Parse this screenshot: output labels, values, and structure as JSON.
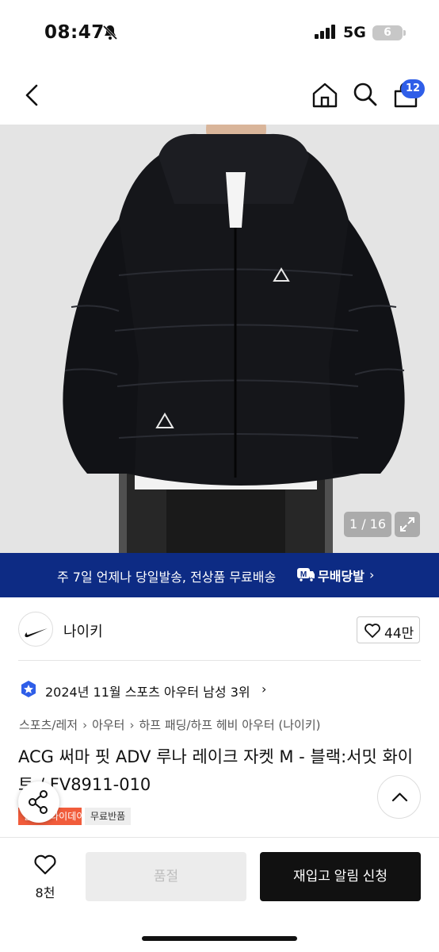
{
  "status_bar": {
    "time": "08:47",
    "network": "5G",
    "battery": "6"
  },
  "nav": {
    "cart_count": "12",
    "icons": [
      "back-icon",
      "home-icon",
      "search-icon",
      "cart-icon"
    ]
  },
  "gallery": {
    "counter": "1 / 16"
  },
  "promo_banner": {
    "text": "주 7일 언제나 당일발송, 전상품 무료배송",
    "brand": "무배당발",
    "chevron": "›"
  },
  "seller": {
    "name": "나이키",
    "likes": "44만"
  },
  "rank": {
    "text": "2024년 11월 스포츠 아우터 남성 3위",
    "chevron": "›"
  },
  "breadcrumb": [
    "스포츠/레저",
    "아우터",
    "하프 패딩/하프 헤비 아우터 (나이키)"
  ],
  "breadcrumb_sep": "›",
  "product": {
    "title": "ACG 써마 핏 ADV 루나 레이크 자켓 M - 블랙:서밋 화이트 / FV8911-010"
  },
  "tags": {
    "sale": "블랙프라이데이세일",
    "free_return": "무료반품"
  },
  "bottom_bar": {
    "wish_count": "8천",
    "soldout_label": "품절",
    "restock_label": "재입고 알림 신청"
  },
  "colors": {
    "banner_bg": "#0d2b84",
    "cart_badge": "#2f5ee8",
    "sale_tag": "#f15c3b"
  }
}
